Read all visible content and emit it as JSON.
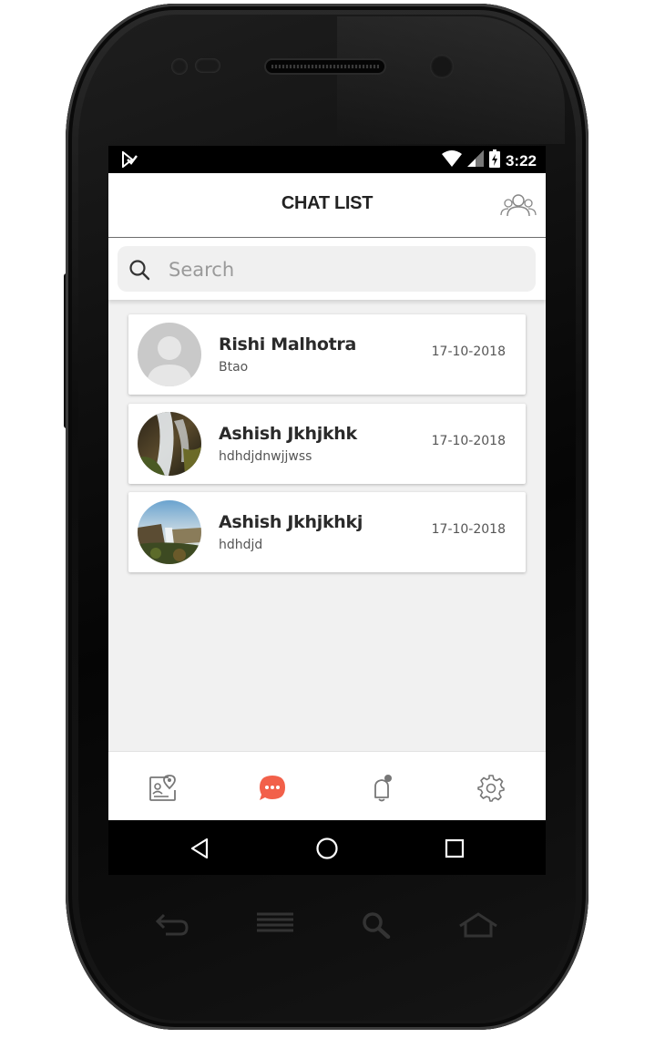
{
  "status_bar": {
    "time": "3:22"
  },
  "header": {
    "title": "CHAT LIST"
  },
  "search": {
    "placeholder": "Search",
    "value": ""
  },
  "chats": [
    {
      "name": "Rishi Malhotra",
      "last_message": "Btao",
      "date": "17-10-2018",
      "avatar": "placeholder-avatar"
    },
    {
      "name": "Ashish Jkhjkhk",
      "last_message": "hdhdjdnwjjwss",
      "date": "17-10-2018",
      "avatar": "waterfall-photo"
    },
    {
      "name": "Ashish Jkhjkhkj",
      "last_message": "hdhdjd",
      "date": "17-10-2018",
      "avatar": "landscape-photo"
    }
  ],
  "bottom_nav": {
    "items": [
      "map-pin-card-icon",
      "chat-bubble-icon",
      "bell-icon",
      "gear-icon"
    ],
    "active": "chat-bubble-icon"
  },
  "colors": {
    "accent": "#f2604a",
    "icon_gray": "#777777"
  }
}
